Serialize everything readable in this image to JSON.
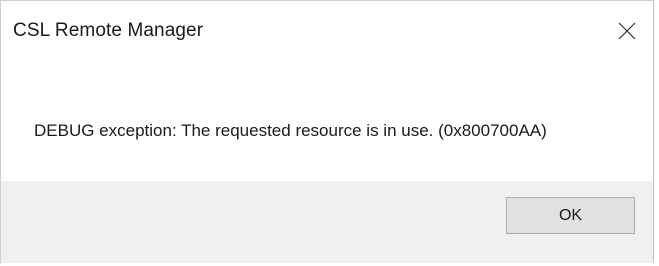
{
  "window": {
    "title": "CSL Remote Manager",
    "close_icon": "close-icon"
  },
  "message": {
    "text": "DEBUG exception: The requested resource is in use. (0x800700AA)"
  },
  "buttons": {
    "ok_label": "OK"
  },
  "colors": {
    "footer_background": "#f0f0f0",
    "button_background": "#e1e1e1",
    "button_border": "#adadad",
    "text": "#1a1a1a"
  }
}
